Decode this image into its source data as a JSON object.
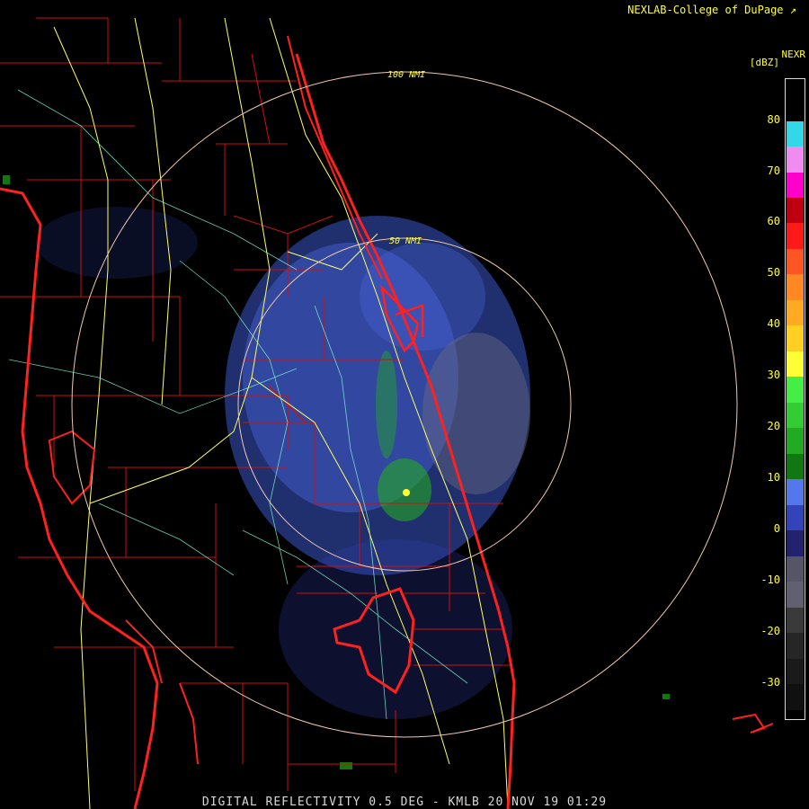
{
  "header": {
    "credit": "NEXLAB-College of DuPage"
  },
  "footer": {
    "product_line": "DIGITAL REFLECTIVITY 0.5 DEG - KMLB 20 NOV 19 01:29"
  },
  "range_rings": {
    "inner_label": "50 NMI",
    "outer_label": "100 NMI"
  },
  "colorbar": {
    "title": "NEXR",
    "unit": "[dBZ]",
    "ticks": [
      "80",
      "70",
      "60",
      "50",
      "40",
      "30",
      "20",
      "10",
      "0",
      "-10",
      "-20",
      "-30"
    ],
    "segments": [
      {
        "from": 80,
        "to": 75,
        "color": "#33d8e8"
      },
      {
        "from": 75,
        "to": 70,
        "color": "#f08cf0"
      },
      {
        "from": 70,
        "to": 65,
        "color": "#ff00cc"
      },
      {
        "from": 65,
        "to": 60,
        "color": "#c00010"
      },
      {
        "from": 60,
        "to": 55,
        "color": "#ff1a1a"
      },
      {
        "from": 55,
        "to": 50,
        "color": "#ff5522"
      },
      {
        "from": 50,
        "to": 45,
        "color": "#ff8822"
      },
      {
        "from": 45,
        "to": 40,
        "color": "#ffaa22"
      },
      {
        "from": 40,
        "to": 35,
        "color": "#ffd022"
      },
      {
        "from": 35,
        "to": 30,
        "color": "#ffff33"
      },
      {
        "from": 30,
        "to": 25,
        "color": "#44ee44"
      },
      {
        "from": 25,
        "to": 20,
        "color": "#33cc33"
      },
      {
        "from": 20,
        "to": 15,
        "color": "#22aa22"
      },
      {
        "from": 15,
        "to": 10,
        "color": "#117711"
      },
      {
        "from": 10,
        "to": 5,
        "color": "#5577ee"
      },
      {
        "from": 5,
        "to": 0,
        "color": "#3344bb"
      },
      {
        "from": 0,
        "to": -5,
        "color": "#22226e"
      },
      {
        "from": -5,
        "to": -10,
        "color": "#555566"
      },
      {
        "from": -10,
        "to": -15,
        "color": "#606070"
      },
      {
        "from": -15,
        "to": -20,
        "color": "#3a3a3a"
      },
      {
        "from": -20,
        "to": -25,
        "color": "#262626"
      },
      {
        "from": -25,
        "to": -30,
        "color": "#1a1a1a"
      },
      {
        "from": -30,
        "to": -35,
        "color": "#101010"
      }
    ]
  },
  "colors": {
    "coastline": "#ff2020",
    "county": "#cc1111",
    "highway": "#ffff66",
    "road": "#7fffd4",
    "ring": "#f0c8b0",
    "text": "#ffff33"
  },
  "icons": {
    "credit_icon": "arrow-icon"
  }
}
